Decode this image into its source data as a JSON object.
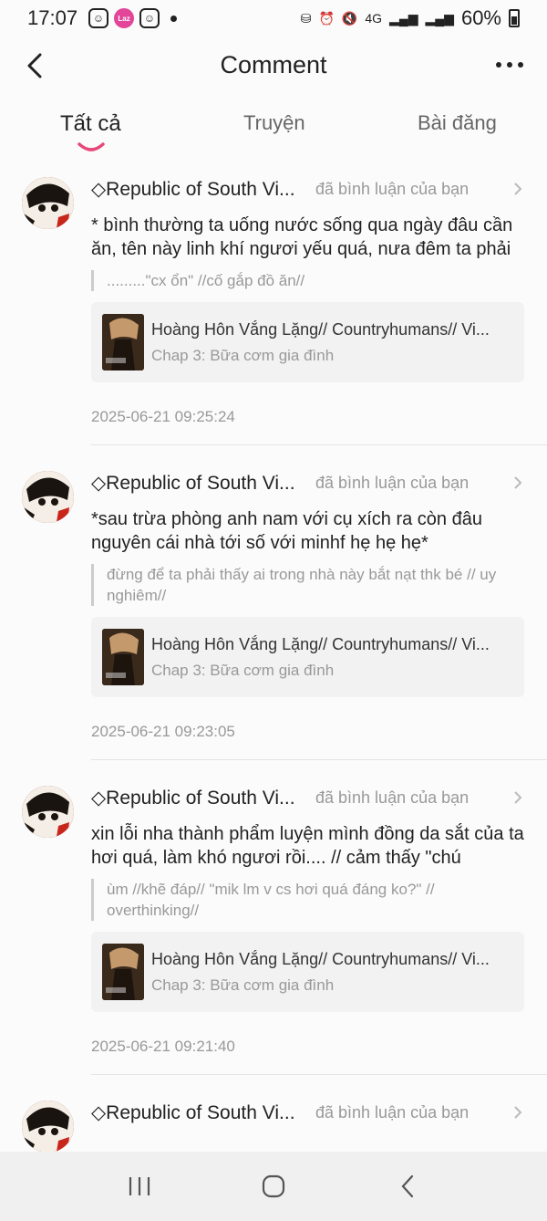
{
  "status_bar": {
    "time": "17:07",
    "battery": "60%",
    "network": "4G",
    "notification_icons": [
      "smiley-icon",
      "lazada-icon",
      "smiley-icon"
    ],
    "lazada_label": "Laz"
  },
  "header": {
    "title": "Comment"
  },
  "tabs": [
    {
      "label": "Tất cả",
      "active": true
    },
    {
      "label": "Truyện",
      "active": false
    },
    {
      "label": "Bài đăng",
      "active": false
    }
  ],
  "accent_color": "#e8477a",
  "comments": [
    {
      "user": "◇Republic of South Vi...",
      "action": "đã bình luận của bạn",
      "text": "* bình thường ta uống nước sống qua ngày đâu cần ăn, tên này linh khí ngươi yếu quá, nưa đêm ta phải",
      "quote": ".........\"cx ổn\" //cố gắp đồ ăn//",
      "story_title": "Hoàng Hôn Vắng Lặng// Countryhumans// Vi...",
      "story_chapter": "Chap 3: Bữa cơm gia đình",
      "time": "2025-06-21 09:25:24"
    },
    {
      "user": "◇Republic of South Vi...",
      "action": "đã bình luận của bạn",
      "text": "*sau trừa phòng anh nam với cụ xích ra còn đâu nguyên cái nhà tới số với minhf hẹ hẹ hẹ*",
      "quote": "đừng để ta phải thấy ai trong nhà này bắt nạt thk bé // uy nghiêm//",
      "story_title": "Hoàng Hôn Vắng Lặng// Countryhumans// Vi...",
      "story_chapter": "Chap 3: Bữa cơm gia đình",
      "time": "2025-06-21 09:23:05"
    },
    {
      "user": "◇Republic of South Vi...",
      "action": "đã bình luận của bạn",
      "text": "xin lỗi nha thành phẩm luyện mình đồng da sắt của ta hơi quá, làm khó ngươi rồi.... // cảm thấy \"chú",
      "quote": "ùm //khẽ đáp// \"mik lm v cs hơi quá đáng ko?\" // overthinking//",
      "story_title": "Hoàng Hôn Vắng Lặng// Countryhumans// Vi...",
      "story_chapter": "Chap 3: Bữa cơm gia đình",
      "time": "2025-06-21 09:21:40"
    },
    {
      "user": "◇Republic of South Vi...",
      "action": "đã bình luận của bạn"
    }
  ]
}
